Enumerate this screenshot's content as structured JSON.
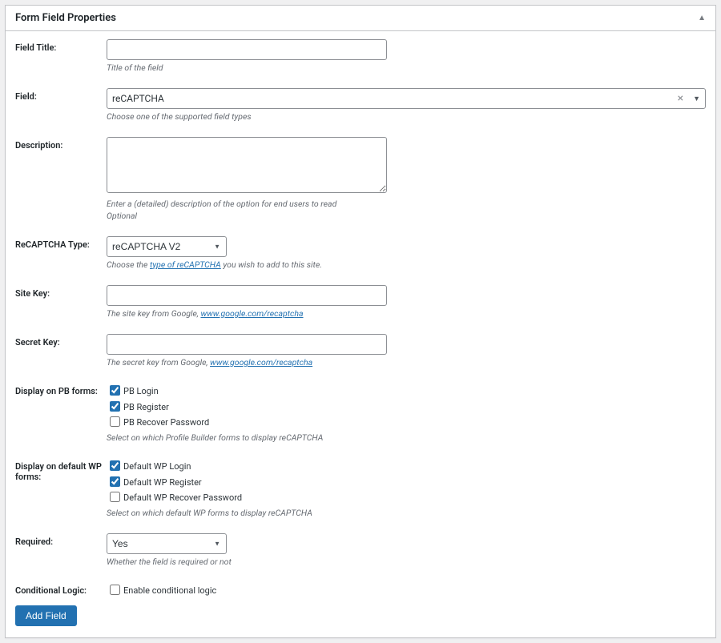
{
  "panel": {
    "title": "Form Field Properties"
  },
  "fieldTitle": {
    "label": "Field Title:",
    "value": "",
    "hint": "Title of the field"
  },
  "field": {
    "label": "Field:",
    "selected": "reCAPTCHA",
    "hint": "Choose one of the supported field types"
  },
  "description": {
    "label": "Description:",
    "value": "",
    "hint1": "Enter a (detailed) description of the option for end users to read",
    "hint2": "Optional"
  },
  "recaptchaType": {
    "label": "ReCAPTCHA Type:",
    "selected": "reCAPTCHA V2",
    "hint_pre": "Choose the ",
    "hint_link": "type of reCAPTCHA",
    "hint_post": " you wish to add to this site."
  },
  "siteKey": {
    "label": "Site Key:",
    "value": "",
    "hint_pre": "The site key from Google, ",
    "hint_link": "www.google.com/recaptcha"
  },
  "secretKey": {
    "label": "Secret Key:",
    "value": "",
    "hint_pre": "The secret key from Google, ",
    "hint_link": "www.google.com/recaptcha"
  },
  "displayPB": {
    "label": "Display on PB forms:",
    "opts": [
      {
        "label": "PB Login",
        "checked": true
      },
      {
        "label": "PB Register",
        "checked": true
      },
      {
        "label": "PB Recover Password",
        "checked": false
      }
    ],
    "hint": "Select on which Profile Builder forms to display reCAPTCHA"
  },
  "displayWP": {
    "label": "Display on default WP forms:",
    "opts": [
      {
        "label": "Default WP Login",
        "checked": true
      },
      {
        "label": "Default WP Register",
        "checked": true
      },
      {
        "label": "Default WP Recover Password",
        "checked": false
      }
    ],
    "hint": "Select on which default WP forms to display reCAPTCHA"
  },
  "required": {
    "label": "Required:",
    "selected": "Yes",
    "hint": "Whether the field is required or not"
  },
  "conditional": {
    "label": "Conditional Logic:",
    "optLabel": "Enable conditional logic",
    "checked": false
  },
  "submit": {
    "label": "Add Field"
  }
}
